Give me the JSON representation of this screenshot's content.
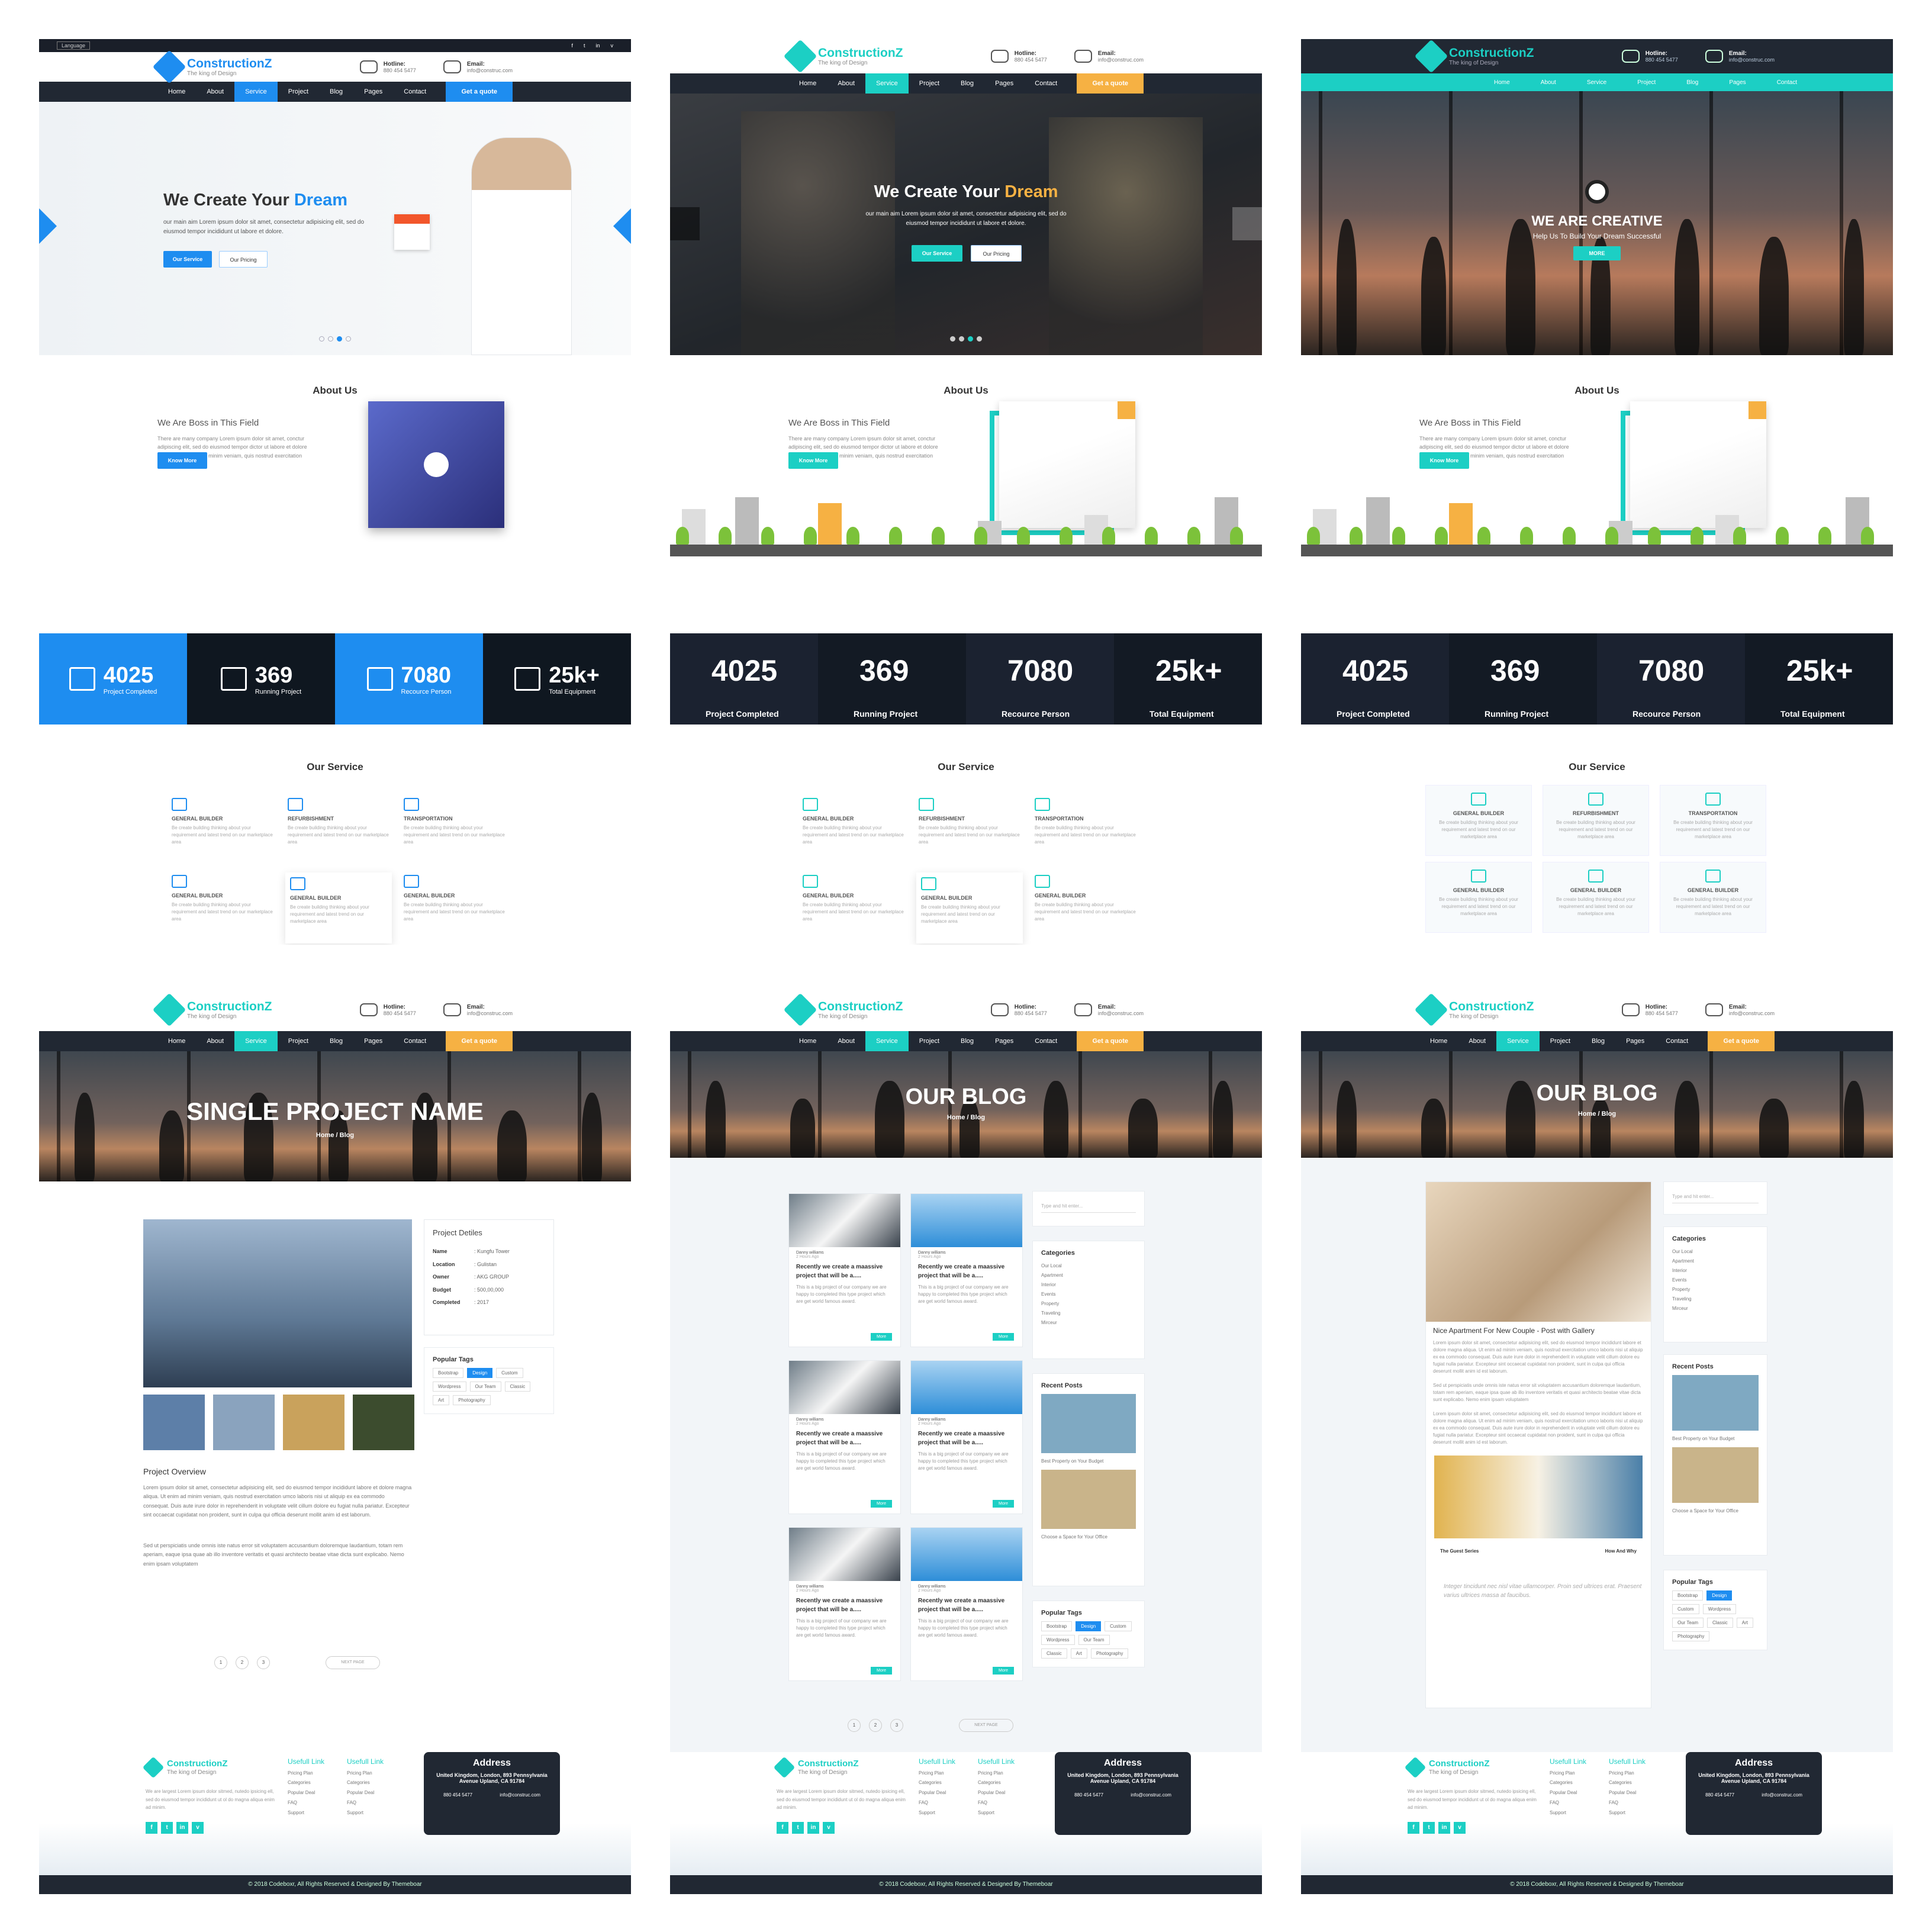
{
  "brand": {
    "name": "ConstructionZ",
    "tagline": "The king of Design"
  },
  "contact": {
    "hotline_label": "Hotline:",
    "hotline": "880 454 5477",
    "email_label": "Email:",
    "email": "info@construc.com"
  },
  "topbar": {
    "language": "Language",
    "social": [
      "f",
      "t",
      "in",
      "v"
    ]
  },
  "nav": [
    "Home",
    "About",
    "Service",
    "Project",
    "Blog",
    "Pages",
    "Contact"
  ],
  "quote": "Get a quote",
  "hero": {
    "title_prefix": "We Create Your",
    "title_accent": "Dream",
    "desc_line1": "our main aim Lorem ipsum dolor sit amet, consectetur adipisicing elit, sed do",
    "desc_line2": "eiusmod tempor incididunt ut labore et dolore.",
    "btn_service": "Our Service",
    "btn_pricing": "Our Pricing",
    "creative_title": "WE ARE CREATIVE",
    "creative_sub": "Help Us To Build Your Dream Successful",
    "creative_btn": "MORE"
  },
  "about": {
    "title": "About Us",
    "subtitle": "We Are Boss in This Field",
    "text": "There are many company Lorem ipsum dolor sit amet, conctur adipiscing elit, sed do eiusmod tempor dictor ut labore et dolore magna aliqu enim ad minim veniam, quis nostrud exercitation ullamco.",
    "button": "Know More"
  },
  "stats": [
    {
      "value": "4025",
      "label": "Project Completed"
    },
    {
      "value": "369",
      "label": "Running Project"
    },
    {
      "value": "7080",
      "label": "Recource Person"
    },
    {
      "value": "25k+",
      "label": "Total Equipment"
    }
  ],
  "services": {
    "title": "Our Service",
    "items": [
      {
        "name": "GENERAL BUILDER",
        "icon": "building-icon"
      },
      {
        "name": "REFURBISHMENT",
        "icon": "tools-icon"
      },
      {
        "name": "TRANSPORTATION",
        "icon": "crane-icon"
      },
      {
        "name": "GENERAL BUILDER",
        "icon": "drill-icon"
      },
      {
        "name": "GENERAL BUILDER",
        "icon": "excavator-icon"
      },
      {
        "name": "GENERAL BUILDER",
        "icon": "worker-icon"
      }
    ],
    "text": "Be create building thinking about your requirement and latest trend on our marketplace area"
  },
  "project": {
    "page_title": "SINGLE PROJECT NAME",
    "crumb": "Home / Blog",
    "details_title": "Project Detiles",
    "details": [
      {
        "k": "Name",
        "v": ": Kungfu Tower"
      },
      {
        "k": "Location",
        "v": ": Gulistan"
      },
      {
        "k": "Owner",
        "v": ": AKG GROUP"
      },
      {
        "k": "Budget",
        "v": ": 500,00,000"
      },
      {
        "k": "Completed",
        "v": ": 2017"
      }
    ],
    "overview_title": "Project Overview",
    "overview_p1": "Lorem ipsum dolor sit amet, consectetur adipisicing elit, sed do eiusmod tempor incididunt labore et dolore magna aliqua. Ut enim ad minim veniam, quis nostrud exercitation umco laboris nisi ut aliquip ex ea commodo consequat. Duis aute irure dolor in reprehenderit in voluptate velit cillum dolore eu fugiat nulla pariatur. Excepteur sint occaecat cupidatat non proident, sunt in culpa qui officia deserunt mollit anim id est laborum.",
    "overview_p2": "Sed ut perspiciatis unde omnis iste natus error sit voluptatem accusantium doloremque laudantium, totam rem aperiam, eaque ipsa quae ab illo inventore veritatis et quasi architecto beatae vitae dicta sunt explicabo. Nemo enim ipsam voluptatem"
  },
  "tags_title": "Popular Tags",
  "tags": [
    "Bootstrap",
    "Design",
    "Custom",
    "Wordpress",
    "Our Team",
    "Classic",
    "Art",
    "Photography"
  ],
  "blog": {
    "page_title": "OUR BLOG",
    "crumb": "Home / Blog",
    "author": "Danny williams",
    "date": "2 Hours Ago",
    "post_title": "Recently we create a maassive project that will be a.....",
    "post_text": "This is a big project of our company we are happy to completed this type project which are get world famous award.",
    "more": "More",
    "search_placeholder": "Type and hit enter...",
    "categories_title": "Categories",
    "categories": [
      "Our Local",
      "Apartment",
      "Interior",
      "Events",
      "Property",
      "Traveling",
      "Mirceur"
    ],
    "recent_title": "Recent Posts",
    "recent": [
      "Best Property on Your Budget",
      "Choose a Space for Your Office"
    ],
    "next": "NEXT PAGE",
    "single_title": "Nice Apartment For New Couple - Post with Gallery",
    "single_cap1": "The Guest Series",
    "single_cap2": "How And Why",
    "quote": "Integer tincidunt nec nisl vitae ullamcorper. Proin sed ultrices erat. Praesent varius ultrices massa at faucibus."
  },
  "pages": [
    "1",
    "2",
    "3"
  ],
  "footer": {
    "about": "We are largest Lorem ipsum dolor sitmed, nutedo ipsicing ell, sed do eiusmod tempor incididunt ut ol do magna aliqua enim ad minim.",
    "useful_title": "Usefull Link",
    "links": [
      "Pricing Plan",
      "Categories",
      "Popular Deal",
      "FAQ",
      "Support"
    ],
    "address_title": "Address",
    "address": "United Kingdom, London, 893 Pennsylvania Avenue Upland, CA 91784",
    "copyright": "© 2018 Codeboxr, All Rights Reserved & Designed By Themeboar"
  },
  "colors": {
    "blue": "#1e8df0",
    "teal": "#1ccfc4",
    "orange": "#f6b143",
    "dark": "#212833"
  }
}
